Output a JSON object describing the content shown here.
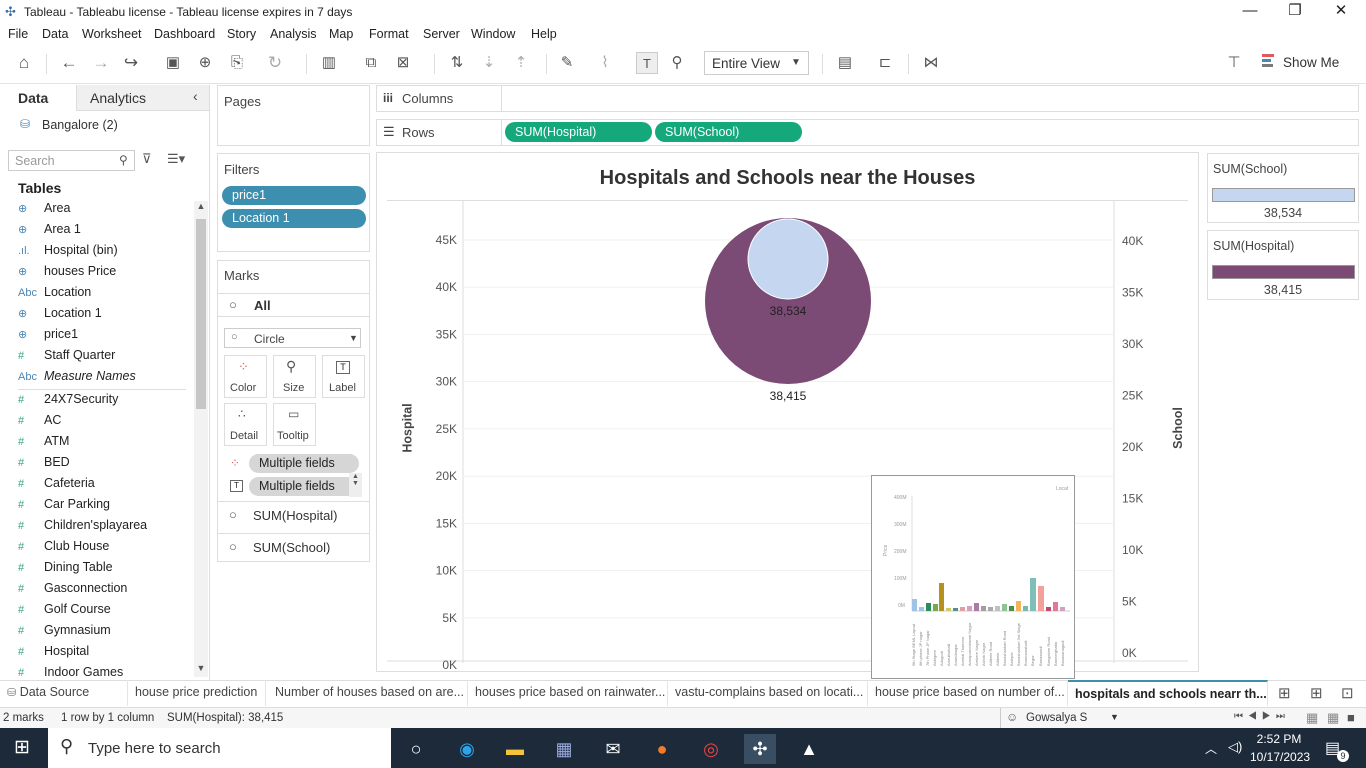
{
  "window": {
    "title": "Tableau - Tableabu license - Tableau license expires in 7 days"
  },
  "menu": [
    "File",
    "Data",
    "Worksheet",
    "Dashboard",
    "Story",
    "Analysis",
    "Map",
    "Format",
    "Server",
    "Window",
    "Help"
  ],
  "toolbar": {
    "view_select": "Entire View",
    "show_me": "Show Me"
  },
  "data_pane": {
    "tab_data": "Data",
    "tab_analytics": "Analytics",
    "datasource": "Bangalore (2)",
    "search_placeholder": "Search",
    "tables_header": "Tables",
    "fields": [
      {
        "icon": "globe",
        "label": "Area"
      },
      {
        "icon": "globe",
        "label": "Area 1"
      },
      {
        "icon": "bin",
        "label": "Hospital (bin)"
      },
      {
        "icon": "globe",
        "label": "houses Price"
      },
      {
        "icon": "Abc",
        "label": "Location"
      },
      {
        "icon": "globe",
        "label": "Location 1"
      },
      {
        "icon": "globe",
        "label": "price1"
      },
      {
        "icon": "#",
        "label": "Staff Quarter"
      },
      {
        "icon": "Abc",
        "label": "Measure Names"
      },
      {
        "icon": "#",
        "label": "24X7Security"
      },
      {
        "icon": "#",
        "label": "AC"
      },
      {
        "icon": "#",
        "label": "ATM"
      },
      {
        "icon": "#",
        "label": "BED"
      },
      {
        "icon": "#",
        "label": "Cafeteria"
      },
      {
        "icon": "#",
        "label": "Car Parking"
      },
      {
        "icon": "#",
        "label": "Children'splayarea"
      },
      {
        "icon": "#",
        "label": "Club House"
      },
      {
        "icon": "#",
        "label": "Dining Table"
      },
      {
        "icon": "#",
        "label": "Gasconnection"
      },
      {
        "icon": "#",
        "label": "Golf Course"
      },
      {
        "icon": "#",
        "label": "Gymnasium"
      },
      {
        "icon": "#",
        "label": "Hospital"
      },
      {
        "icon": "#",
        "label": "Indoor Games"
      }
    ]
  },
  "cards": {
    "pages": "Pages",
    "filters": "Filters",
    "filter_pills": [
      "price1",
      "Location 1"
    ],
    "marks": "Marks",
    "marks_all": "All",
    "mark_type": "Circle",
    "mark_buttons": [
      "Color",
      "Size",
      "Label",
      "Detail",
      "Tooltip"
    ],
    "multi_fields_1": "Multiple fields",
    "multi_fields_2": "Multiple fields",
    "marks_hospital": "SUM(Hospital)",
    "marks_school": "SUM(School)"
  },
  "shelves": {
    "columns_label": "Columns",
    "rows_label": "Rows",
    "rows_pills": [
      "SUM(Hospital)",
      "SUM(School)"
    ]
  },
  "legends": [
    {
      "title": "SUM(School)",
      "value": "38,534",
      "color": "#c5d7f0"
    },
    {
      "title": "SUM(Hospital)",
      "value": "38,415",
      "color": "#7b4a75"
    }
  ],
  "chart_data": {
    "type": "scatter",
    "title": "Hospitals and Schools near the Houses",
    "ylabel": "Hospital",
    "y2label": "School",
    "ylim": [
      0,
      45000
    ],
    "y2lim": [
      0,
      40000
    ],
    "y_ticks": [
      "45K",
      "40K",
      "35K",
      "30K",
      "25K",
      "20K",
      "15K",
      "10K",
      "5K",
      "0K"
    ],
    "y2_ticks": [
      "40K",
      "35K",
      "30K",
      "25K",
      "20K",
      "15K",
      "10K",
      "5K",
      "0K"
    ],
    "series": [
      {
        "name": "SUM(Hospital)",
        "values": [
          38415
        ],
        "label": "38,415",
        "color": "#7b4a75"
      },
      {
        "name": "SUM(School)",
        "values": [
          38534
        ],
        "label": "38,534",
        "color": "#c5d7f0"
      }
    ]
  },
  "tabs": {
    "datasource": "Data Source",
    "sheets": [
      "house price prediction",
      "Number of houses based on are...",
      "houses price based on rainwater...",
      "vastu-complains based on locati...",
      "house price based on number of...",
      "hospitals and schools nearr th..."
    ]
  },
  "status": {
    "marks": "2 marks",
    "rows": "1 row by 1 column",
    "sum": "SUM(Hospital): 38,415",
    "user": "Gowsalya S"
  },
  "taskbar": {
    "search_placeholder": "Type here to search",
    "time": "2:52 PM",
    "date": "10/17/2023",
    "notif_count": "9"
  }
}
